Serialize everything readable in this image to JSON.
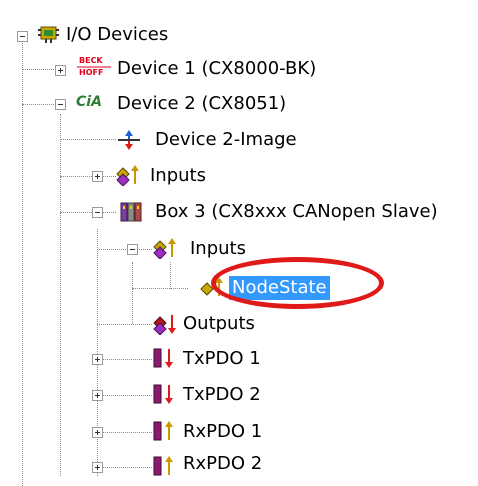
{
  "tree": {
    "root": {
      "label": "I/O Devices",
      "icon": "io-devices-icon",
      "expanded": true
    },
    "device1": {
      "label": "Device 1 (CX8000-BK)",
      "icon_text": [
        "BECK",
        "HOFF"
      ],
      "icon": "beckhoff-logo-icon",
      "expanded": false
    },
    "device2": {
      "label": "Device 2 (CX8051)",
      "icon_text": "CiA",
      "icon": "cia-logo-icon",
      "expanded": true
    },
    "device2_image": {
      "label": "Device 2-Image",
      "icon": "image-transfer-icon"
    },
    "inputs": {
      "label": "Inputs",
      "icon": "inputs-icon",
      "expanded": false
    },
    "box3": {
      "label": "Box 3 (CX8xxx CANopen Slave)",
      "icon": "box-module-icon",
      "expanded": true
    },
    "box3_inputs": {
      "label": "Inputs",
      "icon": "inputs-icon",
      "expanded": true
    },
    "nodestate": {
      "label": "NodeState",
      "icon": "input-variable-icon",
      "selected": true
    },
    "outputs": {
      "label": "Outputs",
      "icon": "outputs-icon"
    },
    "txpdo1": {
      "label": "TxPDO 1",
      "icon": "txpdo-icon",
      "expanded": false
    },
    "txpdo2": {
      "label": "TxPDO 2",
      "icon": "txpdo-icon",
      "expanded": false
    },
    "rxpdo1": {
      "label": "RxPDO 1",
      "icon": "rxpdo-icon",
      "expanded": false
    },
    "rxpdo2": {
      "label": "RxPDO 2",
      "icon": "rxpdo-icon",
      "expanded": false
    }
  },
  "colors": {
    "selection": "#3399ff",
    "highlight_ellipse": "#e01919",
    "beckhoff_red": "#e0001b",
    "cia_green": "#2e7d32"
  }
}
